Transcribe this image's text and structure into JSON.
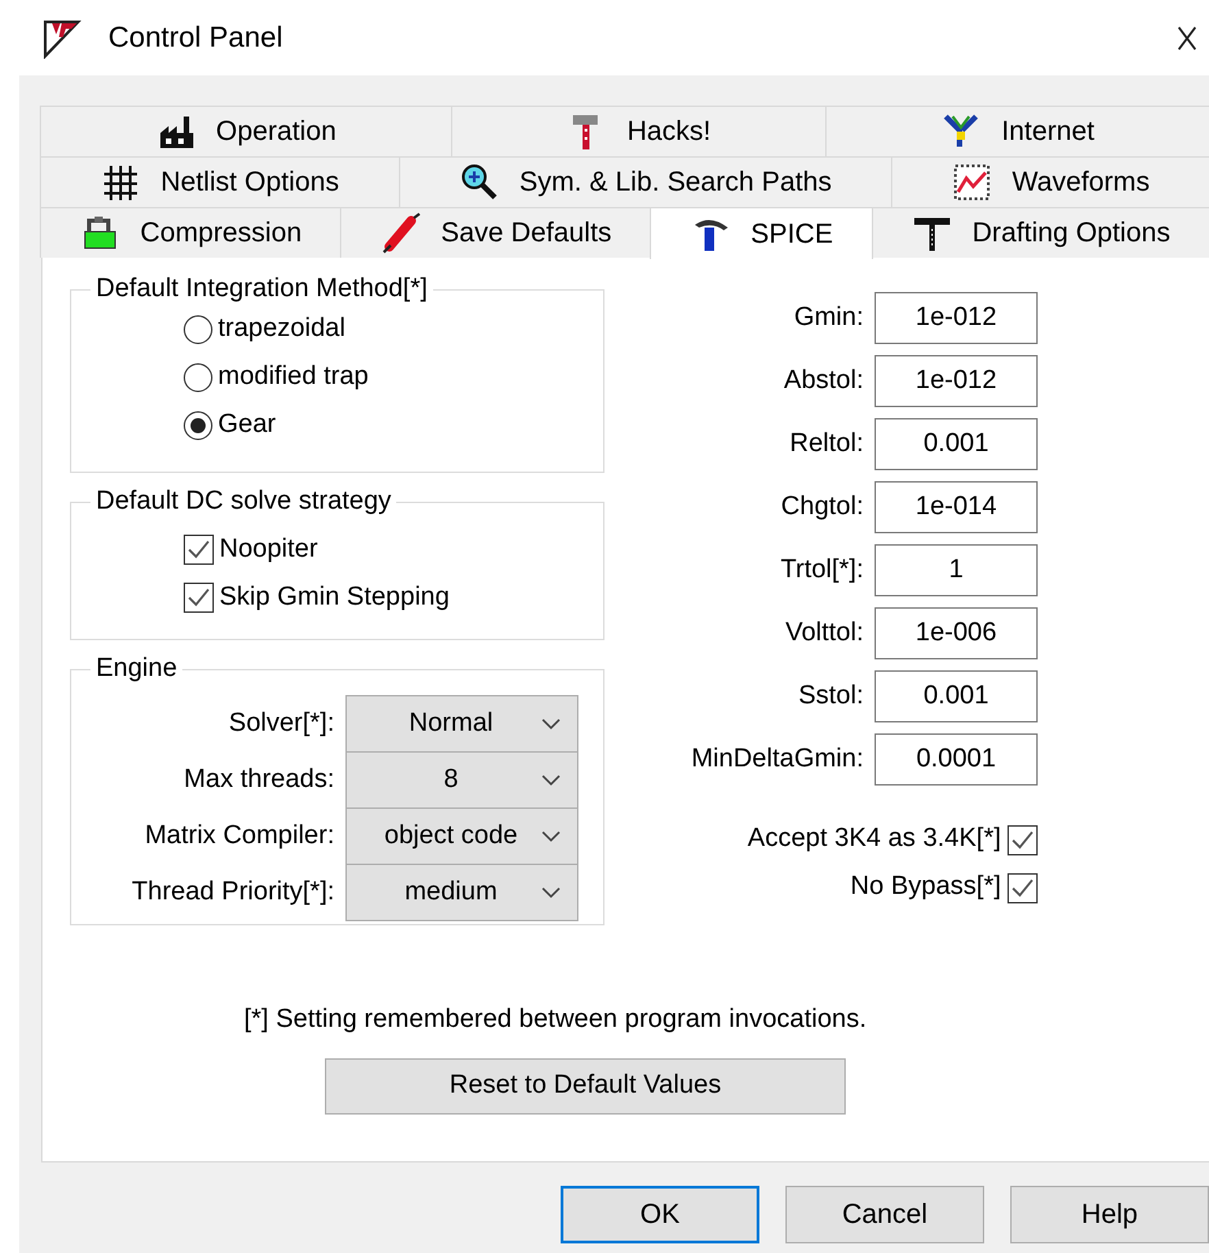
{
  "window": {
    "title": "Control Panel"
  },
  "tab_rows": [
    {
      "tabs": [
        {
          "label": "Operation",
          "selected": false
        },
        {
          "label": "Hacks!",
          "selected": false
        },
        {
          "label": "Internet",
          "selected": false
        }
      ]
    },
    {
      "tabs": [
        {
          "label": "Netlist Options",
          "selected": false
        },
        {
          "label": "Sym. & Lib. Search Paths",
          "selected": false
        },
        {
          "label": "Waveforms",
          "selected": false
        }
      ]
    },
    {
      "tabs": [
        {
          "label": "Compression",
          "selected": false
        },
        {
          "label": "Save Defaults",
          "selected": false
        },
        {
          "label": "SPICE",
          "selected": true
        },
        {
          "label": "Drafting Options",
          "selected": false
        }
      ]
    }
  ],
  "integration_method": {
    "title": "Default Integration Method[*]",
    "options": [
      {
        "label": "trapezoidal",
        "selected": false
      },
      {
        "label": "modified trap",
        "selected": false
      },
      {
        "label": "Gear",
        "selected": true
      }
    ]
  },
  "dc_solve_strategy": {
    "title": "Default DC solve strategy",
    "options": [
      {
        "label": "Noopiter",
        "checked": true
      },
      {
        "label": "Skip Gmin Stepping",
        "checked": true
      }
    ]
  },
  "engine": {
    "title": "Engine",
    "fields": [
      {
        "label": "Solver[*]:",
        "value": "Normal"
      },
      {
        "label": "Max threads:",
        "value": "8"
      },
      {
        "label": "Matrix Compiler:",
        "value": "object code"
      },
      {
        "label": "Thread Priority[*]:",
        "value": "medium"
      }
    ]
  },
  "tolerances": [
    {
      "label": "Gmin:",
      "value": "1e-012"
    },
    {
      "label": "Abstol:",
      "value": "1e-012"
    },
    {
      "label": "Reltol:",
      "value": "0.001"
    },
    {
      "label": "Chgtol:",
      "value": "1e-014"
    },
    {
      "label": "Trtol[*]:",
      "value": "1"
    },
    {
      "label": "Volttol:",
      "value": "1e-006"
    },
    {
      "label": "Sstol:",
      "value": "0.001"
    },
    {
      "label": "MinDeltaGmin:",
      "value": "0.0001"
    }
  ],
  "flags": [
    {
      "label": "Accept 3K4 as 3.4K[*]",
      "checked": true
    },
    {
      "label": "No Bypass[*]",
      "checked": true
    }
  ],
  "note": "[*] Setting remembered between program invocations.",
  "reset_button": "Reset to Default Values",
  "buttons": [
    {
      "label": "OK",
      "focused": true
    },
    {
      "label": "Cancel",
      "focused": false
    },
    {
      "label": "Help",
      "focused": false
    }
  ]
}
